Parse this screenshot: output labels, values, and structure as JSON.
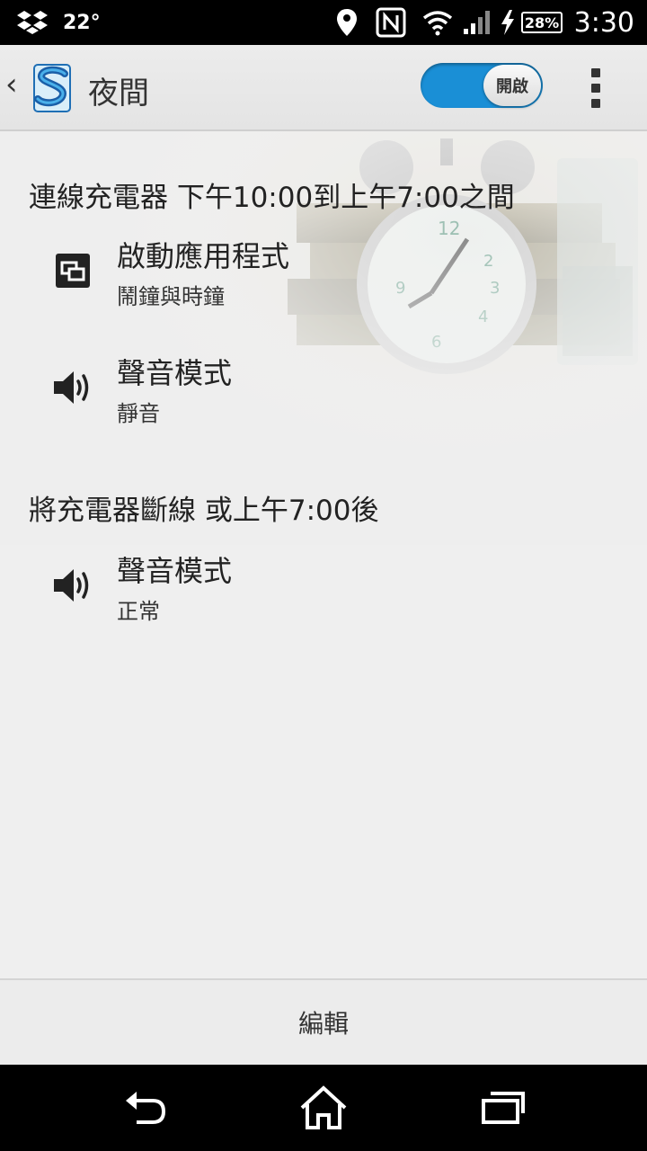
{
  "status_bar": {
    "temperature": "22°",
    "battery_percent": "28%",
    "time": "3:30",
    "icons": [
      "dropbox-icon",
      "location-icon",
      "nfc-icon",
      "wifi-icon",
      "signal-icon",
      "charging-icon",
      "battery-icon"
    ]
  },
  "action_bar": {
    "title": "夜間",
    "toggle_label": "開啟",
    "toggle_state": "on",
    "accent_color": "#1a8fd6"
  },
  "sections": [
    {
      "title": "連線充電器 下午10:00到上午7:00之間",
      "items": [
        {
          "icon": "launch-app-icon",
          "title": "啟動應用程式",
          "subtitle": "鬧鐘與時鐘"
        },
        {
          "icon": "speaker-icon",
          "title": "聲音模式",
          "subtitle": "靜音"
        }
      ]
    },
    {
      "title": "將充電器斷線 或上午7:00後",
      "items": [
        {
          "icon": "speaker-icon",
          "title": "聲音模式",
          "subtitle": "正常"
        }
      ]
    }
  ],
  "bottom_bar": {
    "edit_label": "編輯"
  },
  "nav_bar": {
    "icons": [
      "back-icon",
      "home-icon",
      "recent-apps-icon"
    ]
  }
}
